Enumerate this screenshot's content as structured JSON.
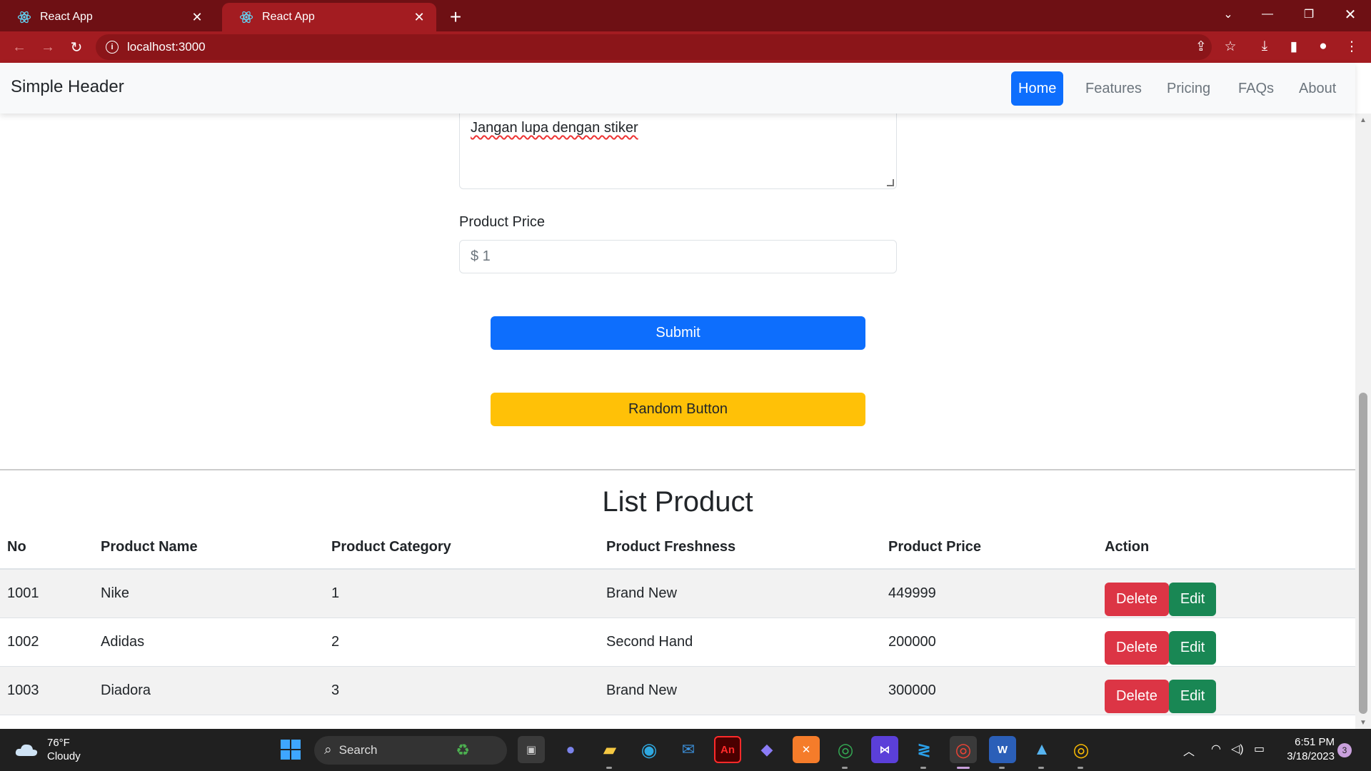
{
  "browser": {
    "tabs": [
      {
        "title": "React App",
        "active": false
      },
      {
        "title": "React App",
        "active": true
      }
    ],
    "url": "localhost:3000",
    "accent_color": "#a31c21"
  },
  "header": {
    "brand": "Simple Header",
    "nav": [
      {
        "label": "Home",
        "active": true
      },
      {
        "label": "Features",
        "active": false
      },
      {
        "label": "Pricing",
        "active": false
      },
      {
        "label": "FAQs",
        "active": false
      },
      {
        "label": "About",
        "active": false
      }
    ]
  },
  "form": {
    "description_value": "Jangan lupa dengan stiker",
    "price_label": "Product Price",
    "price_value": "$ 1",
    "submit_label": "Submit",
    "random_label": "Random Button"
  },
  "list": {
    "title": "List Product",
    "columns": [
      "No",
      "Product Name",
      "Product Category",
      "Product Freshness",
      "Product Price",
      "Action"
    ],
    "rows": [
      {
        "no": "1001",
        "name": "Nike",
        "category": "1",
        "freshness": "Brand New",
        "price": "449999"
      },
      {
        "no": "1002",
        "name": "Adidas",
        "category": "2",
        "freshness": "Second Hand",
        "price": "200000"
      },
      {
        "no": "1003",
        "name": "Diadora",
        "category": "3",
        "freshness": "Brand New",
        "price": "300000"
      }
    ],
    "delete_label": "Delete",
    "edit_label": "Edit"
  },
  "taskbar": {
    "weather_temp": "76°F",
    "weather_desc": "Cloudy",
    "search_label": "Search",
    "time": "6:51 PM",
    "date": "3/18/2023",
    "notification_count": "3"
  }
}
